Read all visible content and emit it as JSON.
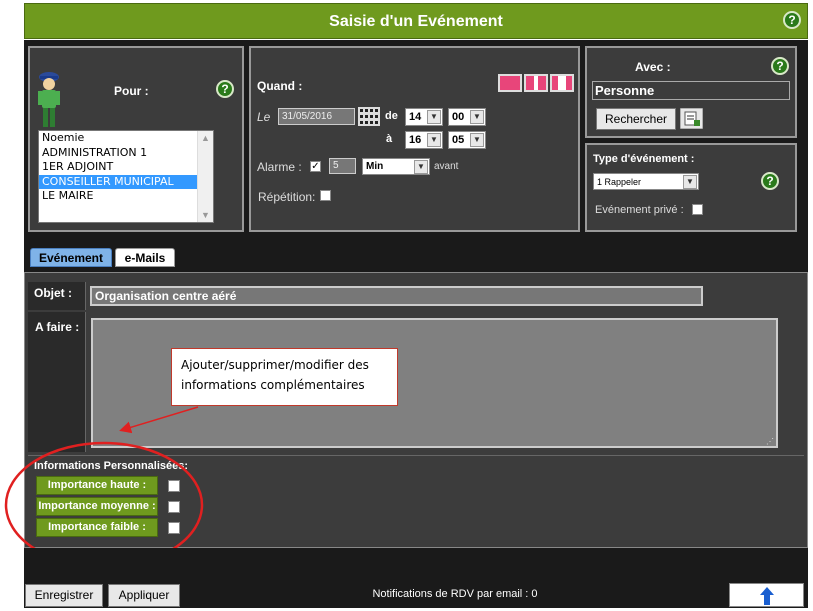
{
  "title": "Saisie d'un Evénement",
  "help_glyph": "?",
  "pour": {
    "label": "Pour :",
    "items": [
      "Noemie",
      "ADMINISTRATION 1",
      "1ER ADJOINT",
      "CONSEILLER MUNICIPAL",
      "LE MAIRE"
    ],
    "selected": "CONSEILLER MUNICIPAL"
  },
  "quand": {
    "label": "Quand :",
    "le_label": "Le",
    "date": "31/05/2016",
    "de_label": "de",
    "de_hour": "14",
    "de_min": "00",
    "a_label": "à",
    "a_hour": "16",
    "a_min": "05",
    "alarme_label": "Alarme :",
    "alarme_checked": true,
    "alarme_value": "5",
    "alarme_unit": "Min",
    "avant_label": "avant",
    "repetition_label": "Répétition:"
  },
  "avec": {
    "label": "Avec :",
    "value": "Personne",
    "search_button": "Rechercher"
  },
  "type_event": {
    "label": "Type d'événement :",
    "value": "1 Rappeler",
    "prive_label": "Evénement privé :"
  },
  "tabs": [
    "Evénement",
    "e-Mails"
  ],
  "objet": {
    "label": "Objet :",
    "value": "Organisation centre aéré"
  },
  "afaire": {
    "label": "A faire :"
  },
  "infos": {
    "label": "Informations Personnalisées:",
    "items": [
      "Importance haute :",
      "Importance moyenne :",
      "Importance faible :"
    ]
  },
  "annotation": {
    "line1": "Ajouter/supprimer/modifier des",
    "line2": "informations complémentaires"
  },
  "footer": {
    "save_button": "Enregistrer",
    "apply_button": "Appliquer",
    "notifications": "Notifications de RDV par email : 0"
  },
  "colors": {
    "brand": "#6f9a1e",
    "panel": "#3c3c3c",
    "selection": "#3399ff",
    "annotation": "#e02020"
  }
}
